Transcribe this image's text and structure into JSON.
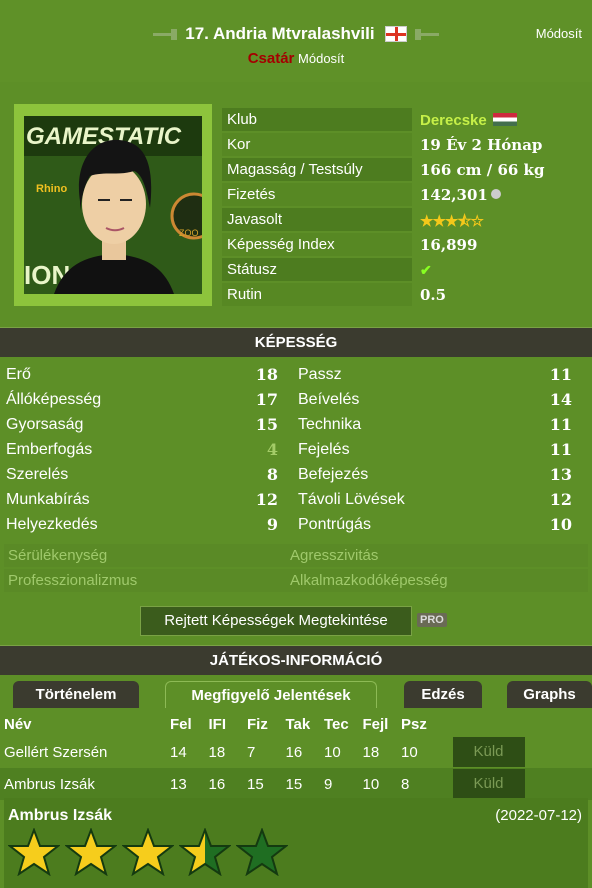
{
  "header": {
    "player_name": "17. Andria Mtvralashvili",
    "edit_top": "Módosít",
    "position": "Csatár",
    "edit_position": "Módosít"
  },
  "info": [
    {
      "label": "Klub",
      "value": "Derecske"
    },
    {
      "label": "Kor",
      "value": "19 Év 2 Hónap"
    },
    {
      "label": "Magasság / Testsúly",
      "value": "166 cm / 66 kg"
    },
    {
      "label": "Fizetés",
      "value": "142,301"
    },
    {
      "label": "Javasolt",
      "value": "★★★⯪☆",
      "rating": 3.5
    },
    {
      "label": "Képesség Index",
      "value": "16,899"
    },
    {
      "label": "Státusz",
      "value": "✔"
    },
    {
      "label": "Rutin",
      "value": "0.5"
    }
  ],
  "skills_title": "KÉPESSÉG",
  "skills": [
    {
      "l": "Erő",
      "lv": "18",
      "r": "Passz",
      "rv": "11"
    },
    {
      "l": "Állóképesség",
      "lv": "17",
      "r": "Beívelés",
      "rv": "14"
    },
    {
      "l": "Gyorsaság",
      "lv": "15",
      "r": "Technika",
      "rv": "11"
    },
    {
      "l": "Emberfogás",
      "lv": "4",
      "r": "Fejelés",
      "rv": "11"
    },
    {
      "l": "Szerelés",
      "lv": "8",
      "r": "Befejezés",
      "rv": "13"
    },
    {
      "l": "Munkabírás",
      "lv": "12",
      "r": "Távoli Lövések",
      "rv": "12"
    },
    {
      "l": "Helyezkedés",
      "lv": "9",
      "r": "Pontrúgás",
      "rv": "10"
    }
  ],
  "hidden": {
    "a1": "Sérülékenység",
    "b1": "Agresszivitás",
    "a2": "Professzionalizmus",
    "b2": "Alkalmazkodóképesség"
  },
  "hidden_button": "Rejtett Képességek Megtekintése",
  "pro_badge": "PRO",
  "info_title": "JÁTÉKOS-INFORMÁCIÓ",
  "tabs": [
    "Történelem",
    "Megfigyelő Jelentések",
    "Edzés",
    "Graphs"
  ],
  "table": {
    "headers": [
      "Név",
      "Fel",
      "IFI",
      "Fiz",
      "Tak",
      "Tec",
      "Fejl",
      "Psz"
    ],
    "rows": [
      {
        "name": "Gellért Szersén",
        "vals": [
          "14",
          "18",
          "7",
          "16",
          "10",
          "18",
          "10"
        ],
        "action": "Küld"
      },
      {
        "name": "Ambrus Izsák",
        "vals": [
          "13",
          "16",
          "15",
          "15",
          "9",
          "10",
          "8"
        ],
        "action": "Küld"
      }
    ]
  },
  "report": {
    "name": "Ambrus Izsák",
    "date": "(2022-07-12)",
    "rating": 3.5
  },
  "colors": {
    "accent": "#c6f048",
    "position": "#a40000",
    "bar": "#3b3b2f"
  }
}
